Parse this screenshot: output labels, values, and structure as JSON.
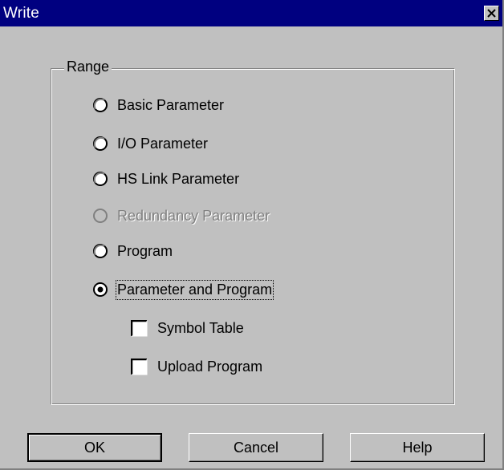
{
  "window": {
    "title": "Write"
  },
  "range": {
    "label": "Range",
    "options": [
      {
        "label": "Basic Parameter",
        "selected": false,
        "enabled": true
      },
      {
        "label": "I/O Parameter",
        "selected": false,
        "enabled": true
      },
      {
        "label": "HS Link Parameter",
        "selected": false,
        "enabled": true
      },
      {
        "label": "Redundancy Parameter",
        "selected": false,
        "enabled": false
      },
      {
        "label": "Program",
        "selected": false,
        "enabled": true
      },
      {
        "label": "Parameter and Program",
        "selected": true,
        "enabled": true
      }
    ],
    "checkboxes": [
      {
        "label": "Symbol Table",
        "checked": false
      },
      {
        "label": "Upload Program",
        "checked": false
      }
    ]
  },
  "buttons": {
    "ok": "OK",
    "cancel": "Cancel",
    "help": "Help"
  },
  "icons": {
    "close": "close-icon",
    "radio": "radio-button",
    "checkbox": "checkbox"
  },
  "colors": {
    "titlebar": "#000080",
    "dialog_bg": "#c0c0c0",
    "disabled_text": "#808080"
  }
}
